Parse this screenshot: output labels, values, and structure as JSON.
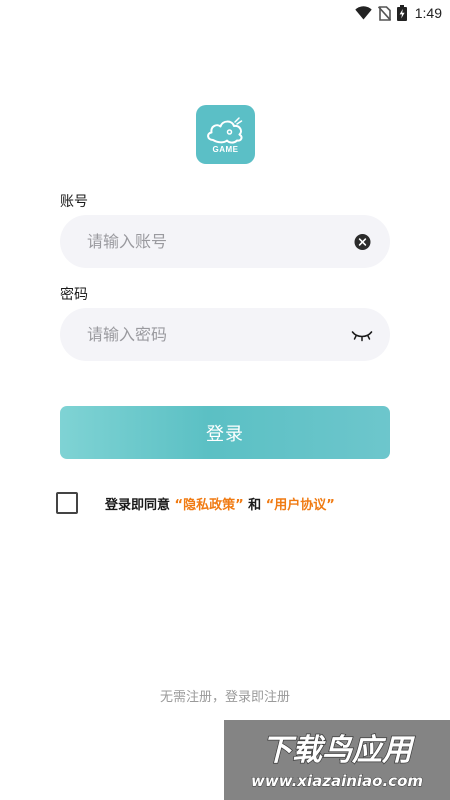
{
  "status_bar": {
    "time": "1:49",
    "icons": [
      "wifi-icon",
      "no-sim-icon",
      "battery-charging-icon"
    ]
  },
  "logo": {
    "text": "GAME",
    "icon": "cloud-icon",
    "bg_color": "#5bbfc6"
  },
  "account": {
    "label": "账号",
    "placeholder": "请输入账号",
    "value": "",
    "clear_icon": "clear-icon"
  },
  "password": {
    "label": "密码",
    "placeholder": "请输入密码",
    "value": "",
    "toggle_icon": "eye-closed-icon"
  },
  "login_button": {
    "label": "登录",
    "colors": [
      "#7fd3d4",
      "#5bc0c4",
      "#6dc6cc"
    ]
  },
  "agreement": {
    "prefix": "登录即同意",
    "privacy": "“隐私政策”",
    "and": "和",
    "terms": "“用户协议”",
    "checked": false,
    "link_color": "#f07b13"
  },
  "footer": {
    "hint": "无需注册，登录即注册"
  },
  "watermark": {
    "title": "下载鸟应用",
    "url": "www.xiazainiao.com"
  }
}
